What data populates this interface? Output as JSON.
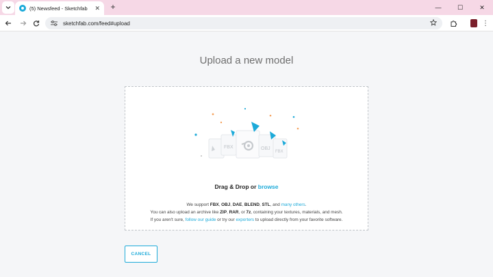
{
  "browser": {
    "tab_title": "(5) Newsfeed - Sketchfab",
    "tab_close": "✕",
    "new_tab": "+",
    "url": "sketchfab.com/feed#upload",
    "window": {
      "minimize": "—",
      "maximize": "☐",
      "close": "✕"
    }
  },
  "page": {
    "title": "Upload a new model",
    "drag_text": "Drag & Drop or ",
    "browse_label": "browse",
    "support_line1": {
      "prefix": "We support ",
      "formats": [
        "FBX",
        "OBJ",
        "DAE",
        "BLEND",
        "STL"
      ],
      "sep": ", ",
      "and": ", and ",
      "link": "many others",
      "suffix": "."
    },
    "support_line2": {
      "prefix": "You can also upload an archive like ",
      "zip": "ZIP",
      "rar": "RAR",
      "or": ", or ",
      "seven": "7z",
      "suffix": ", containing your textures, materials, and mesh."
    },
    "support_line3": {
      "prefix": "If you aren't sure, ",
      "guide_link": "follow our guide",
      "mid": " or try our ",
      "exporters_link": "exporters",
      "suffix": " to upload directly from your favorite software."
    },
    "cancel_label": "CANCEL",
    "file_cards": [
      "FBX",
      "OBJ",
      "FBX"
    ]
  },
  "colors": {
    "accent": "#1caad9",
    "tabstrip": "#f6d8e6",
    "confetti_orange": "#f5a25d"
  },
  "icons": [
    "chevron-down-icon",
    "sketchfab-favicon",
    "back-arrow-icon",
    "forward-arrow-icon",
    "reload-icon",
    "tune-icon",
    "star-icon",
    "extensions-icon",
    "blender-icon"
  ]
}
